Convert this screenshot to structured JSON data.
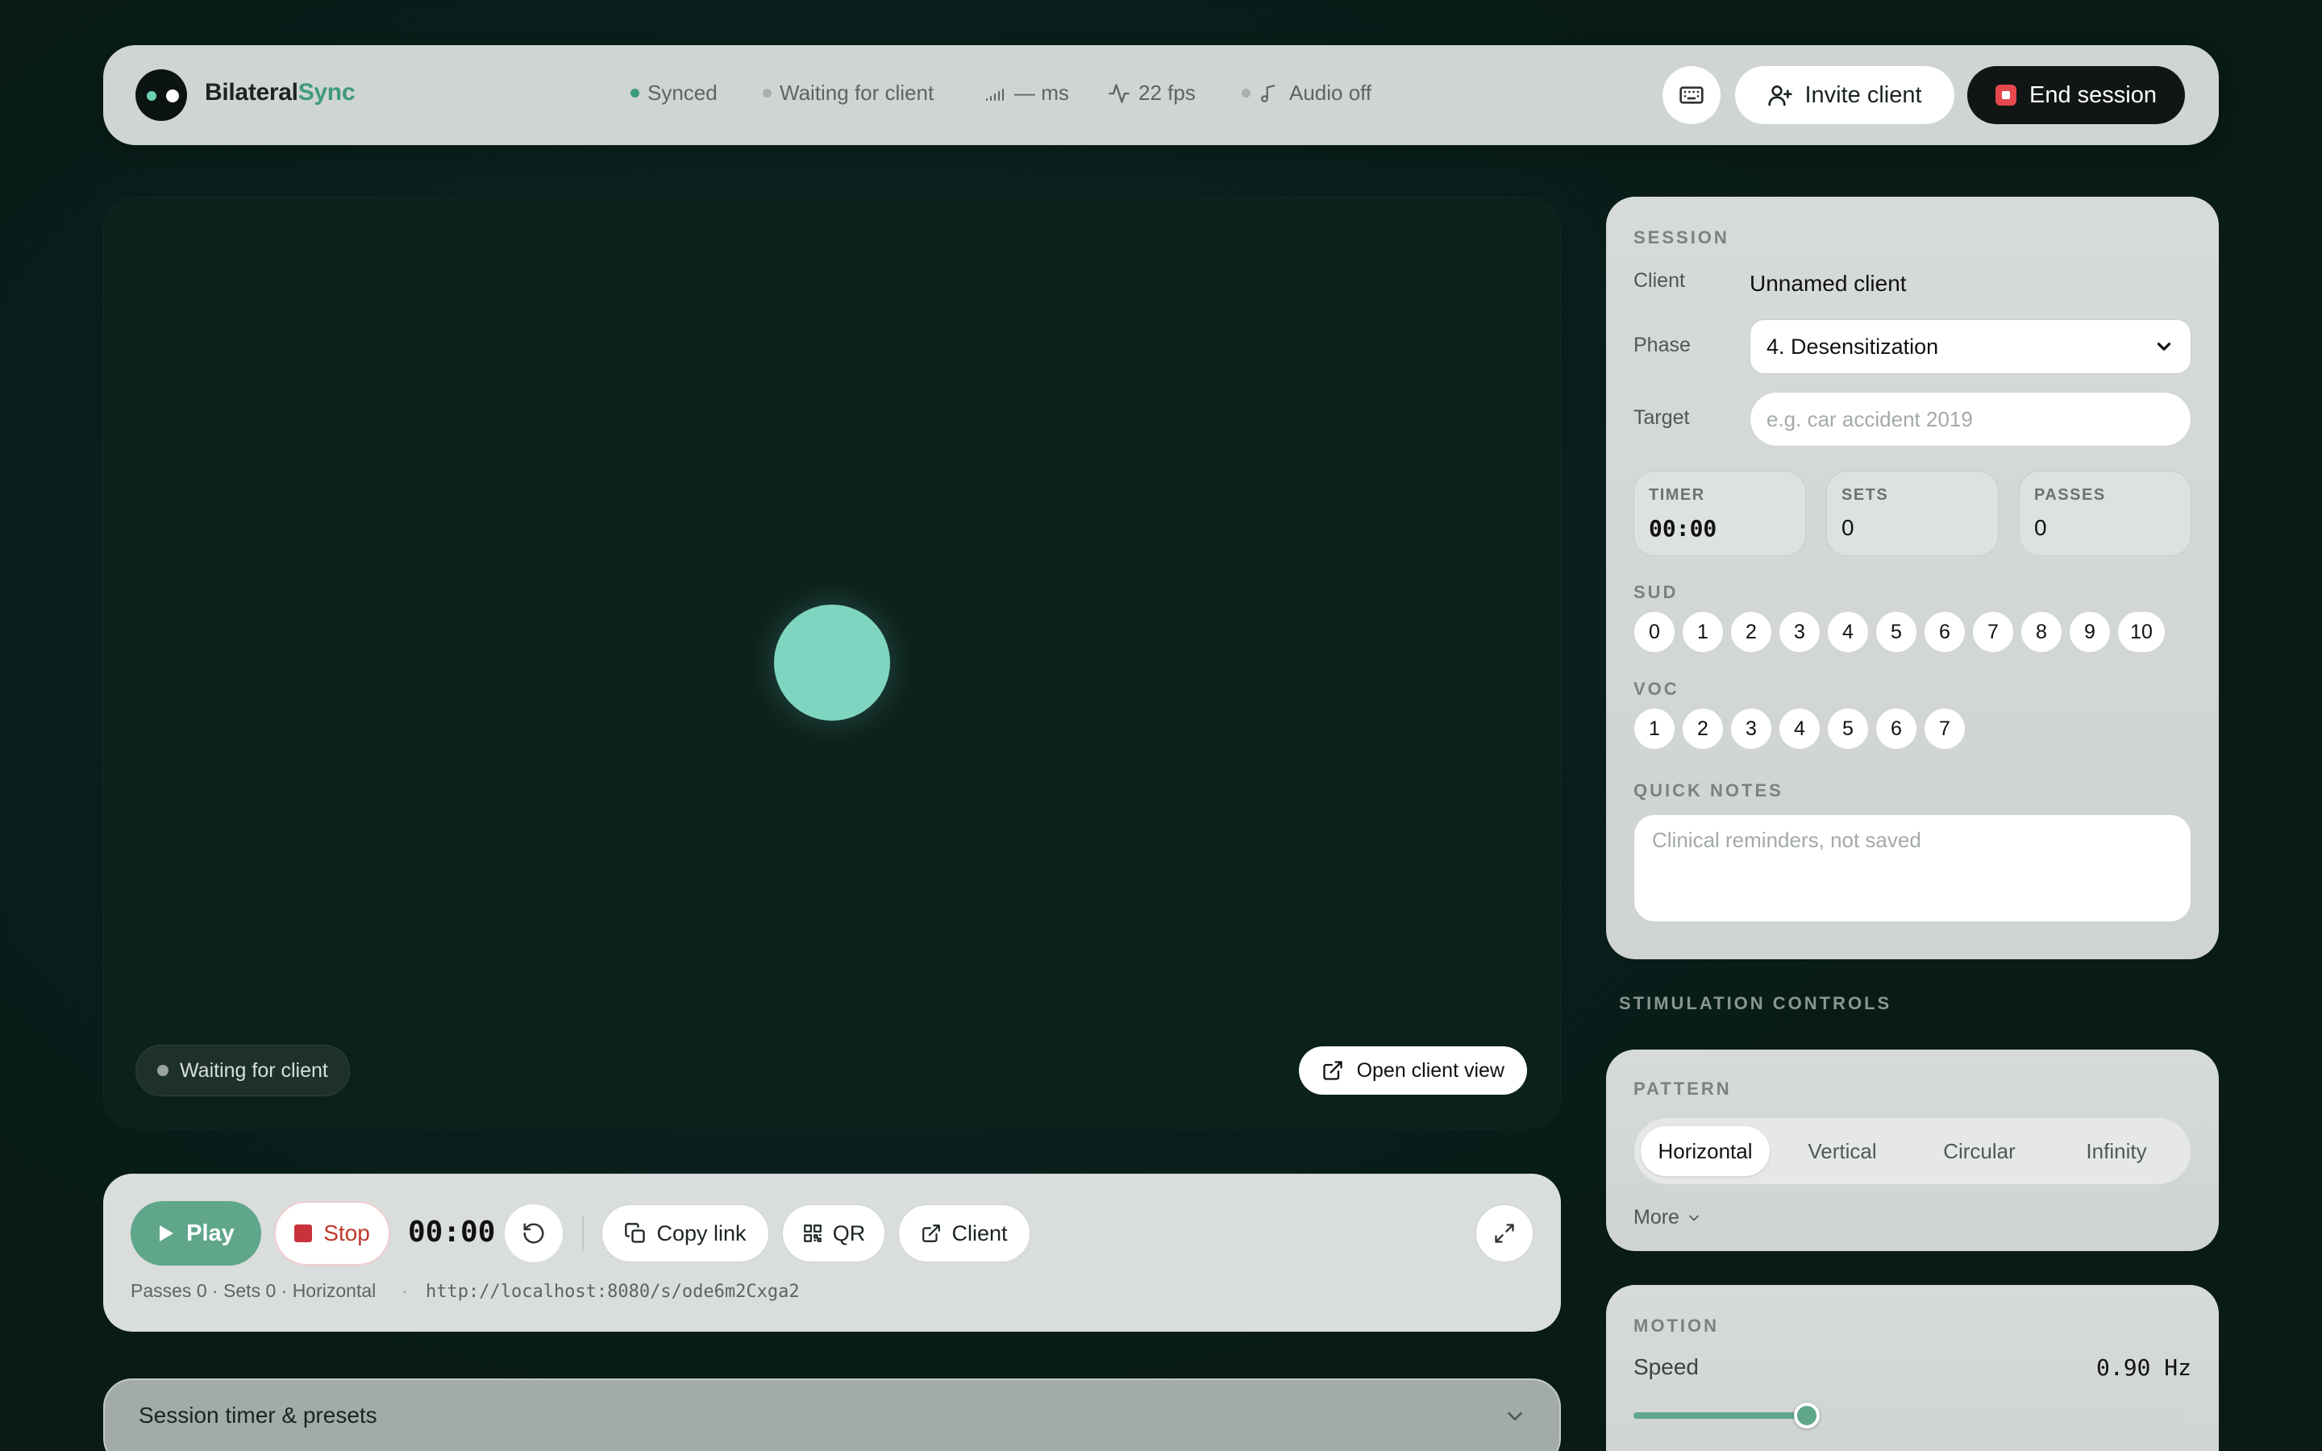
{
  "app": {
    "brand_main": "Bilateral",
    "brand_accent": "Sync"
  },
  "status": {
    "synced": "Synced",
    "client": "Waiting for client",
    "latency": "— ms",
    "fps": "22 fps",
    "audio": "Audio off",
    "synced_color": "#3f9a7c"
  },
  "header": {
    "invite": "Invite client",
    "end": "End session",
    "keyboard_icon": "keyboard-icon"
  },
  "stage": {
    "waiting": "Waiting for client",
    "open_client": "Open client view"
  },
  "controls": {
    "play": "Play",
    "stop": "Stop",
    "clock": "00:00",
    "copy_link": "Copy link",
    "qr": "QR",
    "client": "Client",
    "meta": "Passes 0 · Sets 0 · Horizontal",
    "sep": "·",
    "url": "http://localhost:8080/s/ode6m2Cxga2"
  },
  "presets": {
    "title": "Session timer & presets"
  },
  "session": {
    "title": "SESSION",
    "client_label": "Client",
    "client_value": "Unnamed client",
    "phase_label": "Phase",
    "phase_value": "4. Desensitization",
    "target_label": "Target",
    "target_placeholder": "e.g. car accident 2019",
    "timer_label": "TIMER",
    "timer_value": "00:00",
    "sets_label": "SETS",
    "sets_value": "0",
    "passes_label": "PASSES",
    "passes_value": "0",
    "sud_label": "SUD",
    "sud": [
      "0",
      "1",
      "2",
      "3",
      "4",
      "5",
      "6",
      "7",
      "8",
      "9",
      "10"
    ],
    "voc_label": "VOC",
    "voc": [
      "1",
      "2",
      "3",
      "4",
      "5",
      "6",
      "7"
    ],
    "notes_label": "QUICK NOTES",
    "notes_placeholder": "Clinical reminders, not saved"
  },
  "stimulation": {
    "title": "STIMULATION CONTROLS",
    "pattern_label": "PATTERN",
    "patterns": [
      "Horizontal",
      "Vertical",
      "Circular",
      "Infinity"
    ],
    "active_pattern": "Horizontal",
    "more": "More",
    "motion_label": "MOTION",
    "speed_label": "Speed",
    "speed_value": "0.90 Hz",
    "speed_fraction": 0.31
  }
}
